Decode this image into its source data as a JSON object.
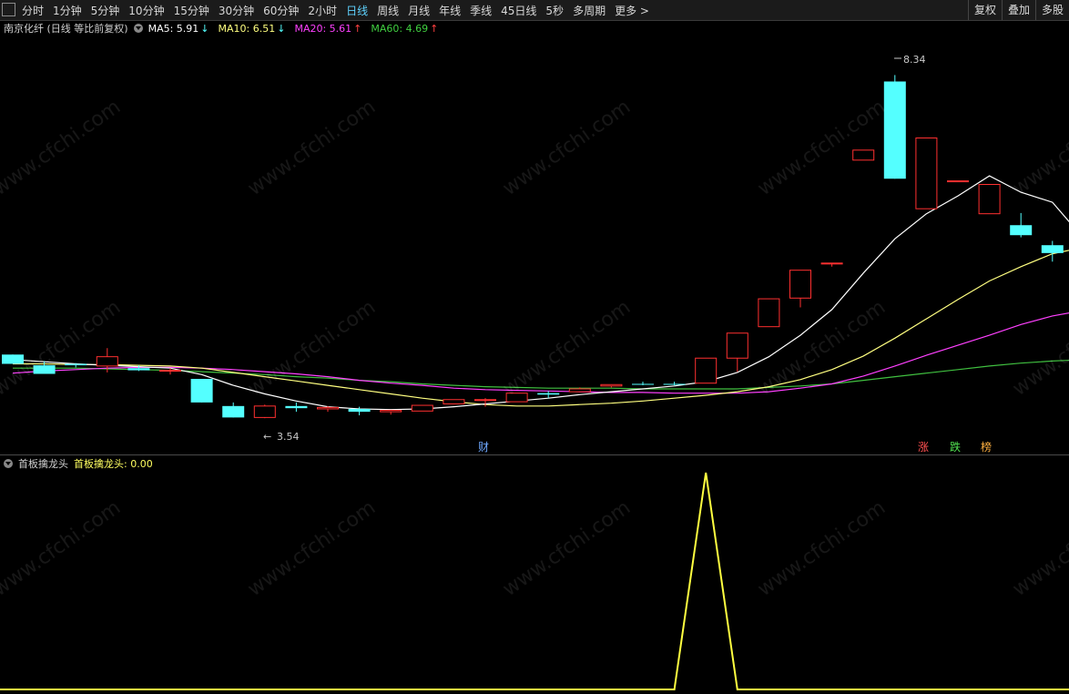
{
  "toolbar": {
    "periods": [
      "分时",
      "1分钟",
      "5分钟",
      "10分钟",
      "15分钟",
      "30分钟",
      "60分钟",
      "2小时",
      "日线",
      "周线",
      "月线",
      "年线",
      "季线",
      "45日线",
      "5秒",
      "多周期",
      "更多 >"
    ],
    "active_period": "日线",
    "right_buttons": [
      "复权",
      "叠加",
      "多股"
    ]
  },
  "stock_info": {
    "name": "南京化纤 (日线 等比前复权)",
    "ma5": "MA5: 5.91",
    "ma5_arrow": "↓",
    "ma10": "MA10: 6.51",
    "ma10_arrow": "↓",
    "ma20": "MA20: 5.61",
    "ma20_arrow": "↑",
    "ma60": "MA60: 4.69",
    "ma60_arrow": "↑"
  },
  "indicator": {
    "name": "首板擒龙头",
    "value_label": "首板擒龙头: 0.00"
  },
  "markers": {
    "high_label": "8.34",
    "low_label": "3.54",
    "event_cai": "财",
    "event_zhang": "涨",
    "event_die": "跌",
    "event_bang": "榜"
  },
  "watermark": "www.cfchi.com",
  "colors": {
    "background": "#000000",
    "up": "#ff3030",
    "down": "#54ffff",
    "ma5": "#ffffff",
    "ma10": "#ffff80",
    "ma20": "#ff40ff",
    "ma60": "#40c040",
    "indicator": "#ffff40",
    "active_tab": "#5fd3ff"
  },
  "chart_data": {
    "type": "candlestick",
    "price_range": [
      3.3,
      8.6
    ],
    "candles": [
      {
        "o": 4.43,
        "h": 4.43,
        "l": 4.3,
        "c": 4.3
      },
      {
        "o": 4.28,
        "h": 4.34,
        "l": 4.16,
        "c": 4.16
      },
      {
        "o": 4.3,
        "h": 4.31,
        "l": 4.25,
        "c": 4.28
      },
      {
        "o": 4.27,
        "h": 4.52,
        "l": 4.18,
        "c": 4.4
      },
      {
        "o": 4.24,
        "h": 4.28,
        "l": 4.2,
        "c": 4.21
      },
      {
        "o": 4.21,
        "h": 4.24,
        "l": 4.15,
        "c": 4.21
      },
      {
        "o": 4.09,
        "h": 4.09,
        "l": 3.76,
        "c": 3.76
      },
      {
        "o": 3.71,
        "h": 3.76,
        "l": 3.55,
        "c": 3.55
      },
      {
        "o": 3.55,
        "h": 3.73,
        "l": 3.54,
        "c": 3.71
      },
      {
        "o": 3.71,
        "h": 3.76,
        "l": 3.63,
        "c": 3.68
      },
      {
        "o": 3.67,
        "h": 3.71,
        "l": 3.63,
        "c": 3.69
      },
      {
        "o": 3.67,
        "h": 3.7,
        "l": 3.58,
        "c": 3.63
      },
      {
        "o": 3.63,
        "h": 3.65,
        "l": 3.59,
        "c": 3.65
      },
      {
        "o": 3.64,
        "h": 3.72,
        "l": 3.64,
        "c": 3.72
      },
      {
        "o": 3.74,
        "h": 3.8,
        "l": 3.74,
        "c": 3.8
      },
      {
        "o": 3.8,
        "h": 3.82,
        "l": 3.7,
        "c": 3.8
      },
      {
        "o": 3.77,
        "h": 3.89,
        "l": 3.77,
        "c": 3.89
      },
      {
        "o": 3.89,
        "h": 3.92,
        "l": 3.82,
        "c": 3.87
      },
      {
        "o": 3.91,
        "h": 3.97,
        "l": 3.91,
        "c": 3.95
      },
      {
        "o": 3.99,
        "h": 4.01,
        "l": 3.97,
        "c": 4.01
      },
      {
        "o": 4.02,
        "h": 4.05,
        "l": 4.0,
        "c": 4.01
      },
      {
        "o": 4.02,
        "h": 4.05,
        "l": 4.0,
        "c": 4.01
      },
      {
        "o": 4.03,
        "h": 4.38,
        "l": 4.03,
        "c": 4.38
      },
      {
        "o": 4.38,
        "h": 4.73,
        "l": 4.19,
        "c": 4.73
      },
      {
        "o": 4.82,
        "h": 5.21,
        "l": 4.82,
        "c": 5.21
      },
      {
        "o": 5.22,
        "h": 5.61,
        "l": 5.09,
        "c": 5.61
      },
      {
        "o": 5.71,
        "h": 5.71,
        "l": 5.66,
        "c": 5.71
      },
      {
        "o": 7.15,
        "h": 7.29,
        "l": 7.15,
        "c": 7.29
      },
      {
        "o": 8.25,
        "h": 8.34,
        "l": 6.89,
        "c": 6.89
      },
      {
        "o": 6.47,
        "h": 7.46,
        "l": 6.47,
        "c": 7.46
      },
      {
        "o": 6.86,
        "h": 6.86,
        "l": 6.86,
        "c": 6.86
      },
      {
        "o": 6.4,
        "h": 6.81,
        "l": 6.4,
        "c": 6.81
      },
      {
        "o": 6.24,
        "h": 6.41,
        "l": 6.07,
        "c": 6.1
      },
      {
        "o": 5.96,
        "h": 6.02,
        "l": 5.73,
        "c": 5.85
      }
    ],
    "ma5": [
      4.36,
      4.33,
      4.3,
      4.28,
      4.26,
      4.24,
      4.15,
      4.0,
      3.88,
      3.78,
      3.7,
      3.67,
      3.66,
      3.67,
      3.7,
      3.74,
      3.78,
      3.82,
      3.87,
      3.91,
      3.95,
      3.99,
      4.05,
      4.18,
      4.4,
      4.7,
      5.06,
      5.57,
      6.05,
      6.4,
      6.65,
      6.93,
      6.7,
      6.56,
      6.05
    ],
    "ma10": [
      4.3,
      4.3,
      4.29,
      4.29,
      4.28,
      4.27,
      4.24,
      4.18,
      4.12,
      4.06,
      4.0,
      3.94,
      3.88,
      3.82,
      3.77,
      3.73,
      3.71,
      3.71,
      3.73,
      3.75,
      3.78,
      3.82,
      3.86,
      3.91,
      3.98,
      4.08,
      4.22,
      4.41,
      4.66,
      4.93,
      5.2,
      5.46,
      5.66,
      5.84,
      5.93
    ],
    "ma20": [
      4.17,
      4.2,
      4.22,
      4.24,
      4.25,
      4.25,
      4.24,
      4.22,
      4.19,
      4.16,
      4.12,
      4.07,
      4.03,
      4.0,
      3.96,
      3.94,
      3.93,
      3.92,
      3.91,
      3.9,
      3.9,
      3.89,
      3.89,
      3.89,
      3.91,
      3.96,
      4.02,
      4.13,
      4.27,
      4.42,
      4.56,
      4.7,
      4.85,
      4.97,
      5.05
    ],
    "ma60": [
      4.24,
      4.24,
      4.24,
      4.23,
      4.22,
      4.21,
      4.19,
      4.17,
      4.15,
      4.12,
      4.1,
      4.07,
      4.05,
      4.02,
      4.0,
      3.98,
      3.97,
      3.96,
      3.96,
      3.96,
      3.95,
      3.95,
      3.95,
      3.95,
      3.97,
      3.99,
      4.02,
      4.07,
      4.12,
      4.17,
      4.22,
      4.27,
      4.31,
      4.34,
      4.36
    ],
    "indicator_values": [
      0,
      0,
      0,
      0,
      0,
      0,
      0,
      0,
      0,
      0,
      0,
      0,
      0,
      0,
      0,
      0,
      0,
      0,
      0,
      0,
      0,
      0,
      1,
      0,
      0,
      0,
      0,
      0,
      0,
      0,
      0,
      0,
      0,
      0,
      0
    ]
  }
}
